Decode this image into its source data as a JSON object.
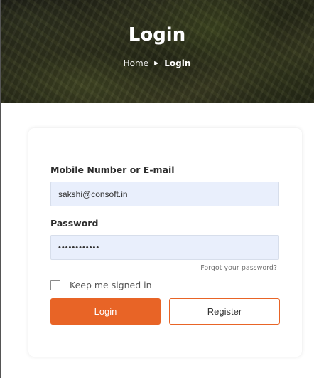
{
  "hero": {
    "title": "Login",
    "breadcrumb": {
      "home": "Home",
      "separator": "▶",
      "current": "Login"
    }
  },
  "form": {
    "mobile_label": "Mobile Number or E-mail",
    "mobile_value": "sakshi@consoft.in",
    "password_label": "Password",
    "password_value": "••••••••••••",
    "forgot_link": "Forgot your password?",
    "remember_label": "Keep me signed in",
    "remember_checked": false,
    "login_button": "Login",
    "register_button": "Register"
  },
  "colors": {
    "accent": "#e86426",
    "field_background": "#e9effc"
  }
}
